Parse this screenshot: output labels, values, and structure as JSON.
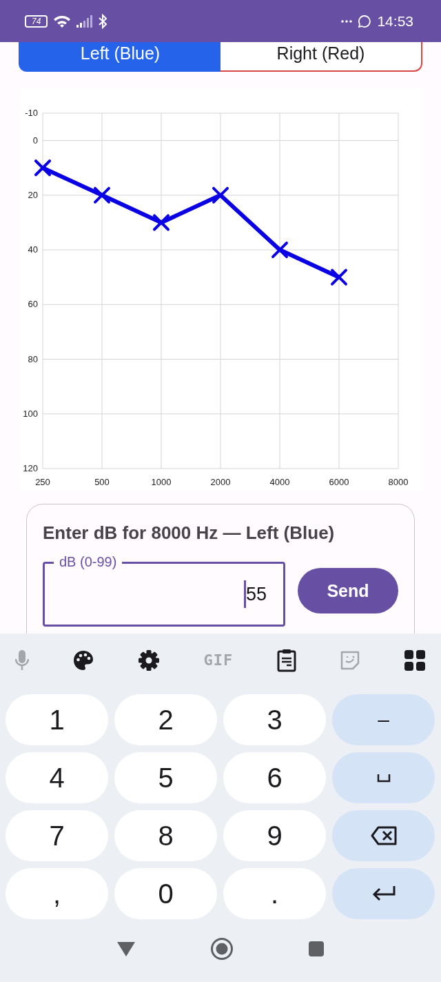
{
  "status_bar": {
    "battery": "74",
    "time": "14:53"
  },
  "tabs": [
    {
      "label": "Left (Blue)",
      "selected": true,
      "color": "#2563eb"
    },
    {
      "label": "Right (Red)",
      "selected": false,
      "color": "#d94545"
    }
  ],
  "chart": {
    "chart_data": {
      "type": "line",
      "categories": [
        "250",
        "500",
        "1000",
        "2000",
        "4000",
        "6000",
        "8000"
      ],
      "ylim": [
        120,
        -10
      ],
      "yticks": [
        -10,
        0,
        20,
        40,
        60,
        80,
        100,
        120
      ],
      "grid": true,
      "series": [
        {
          "color": "#0a00e6",
          "marker": "x",
          "values": [
            10,
            20,
            30,
            20,
            40,
            50,
            null
          ]
        }
      ]
    }
  },
  "entry": {
    "title": "Enter dB for 8000 Hz — Left (Blue)",
    "field": {
      "label": "dB (0-99)",
      "value": "55"
    },
    "button": "Send"
  },
  "keyboard": {
    "toolbar": [
      {
        "kind": "mic",
        "disabled": true
      },
      {
        "kind": "palette",
        "disabled": false
      },
      {
        "kind": "settings",
        "disabled": false
      },
      {
        "kind": "gif",
        "label": "GIF",
        "disabled": true
      },
      {
        "kind": "clipboard",
        "disabled": false
      },
      {
        "kind": "sticker",
        "disabled": true
      },
      {
        "kind": "apps",
        "disabled": false
      }
    ],
    "rows": [
      [
        {
          "kind": "char",
          "label": "1"
        },
        {
          "kind": "char",
          "label": "2"
        },
        {
          "kind": "char",
          "label": "3"
        },
        {
          "kind": "action",
          "label": "–"
        }
      ],
      [
        {
          "kind": "char",
          "label": "4"
        },
        {
          "kind": "char",
          "label": "5"
        },
        {
          "kind": "char",
          "label": "6"
        },
        {
          "kind": "space"
        }
      ],
      [
        {
          "kind": "char",
          "label": "7"
        },
        {
          "kind": "char",
          "label": "8"
        },
        {
          "kind": "char",
          "label": "9"
        },
        {
          "kind": "backspace"
        }
      ],
      [
        {
          "kind": "char",
          "label": ","
        },
        {
          "kind": "char",
          "label": "0"
        },
        {
          "kind": "char",
          "label": "."
        },
        {
          "kind": "enter"
        }
      ]
    ]
  }
}
